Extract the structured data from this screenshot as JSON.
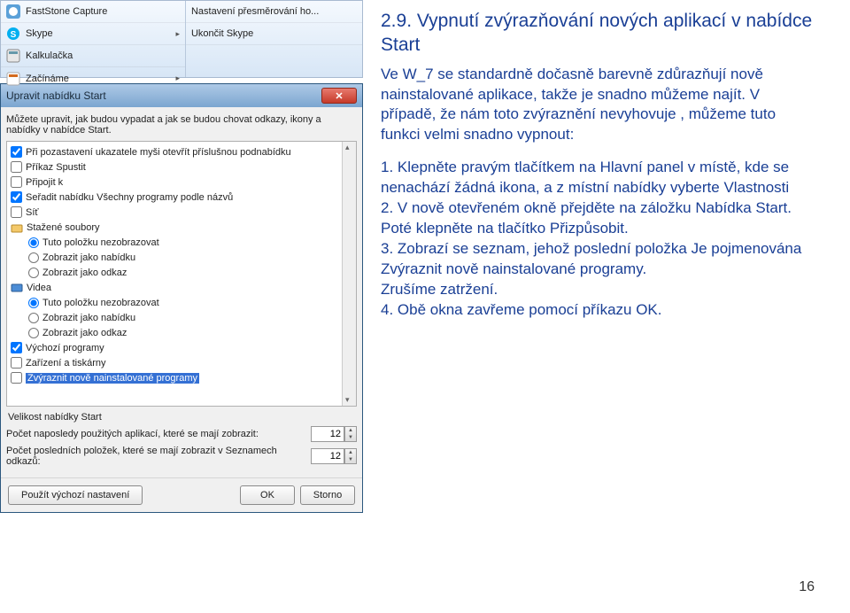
{
  "taskbar": {
    "left": [
      {
        "label": "FastStone Capture",
        "icon": "app-icon"
      },
      {
        "label": "Skype",
        "icon": "skype-icon"
      },
      {
        "label": "Kalkulačka",
        "icon": "calc-icon"
      },
      {
        "label": "Začínáme",
        "icon": "start-icon"
      }
    ],
    "right": [
      {
        "label": "Nastavení přesměrování ho..."
      },
      {
        "label": "Ukončit Skype"
      }
    ]
  },
  "dialog": {
    "title": "Upravit nabídku Start",
    "desc": "Můžete upravit, jak budou vypadat a jak se budou chovat odkazy, ikony a nabídky v nabídce Start.",
    "items": [
      {
        "type": "chk",
        "checked": true,
        "label": "Při pozastavení ukazatele myši otevřít příslušnou podnabídku"
      },
      {
        "type": "chk",
        "checked": false,
        "label": "Příkaz Spustit"
      },
      {
        "type": "chk",
        "checked": false,
        "label": "Připojit k"
      },
      {
        "type": "chk",
        "checked": true,
        "label": "Seřadit nabídku Všechny programy podle názvů"
      },
      {
        "type": "chk",
        "checked": false,
        "label": "Síť"
      },
      {
        "type": "grp",
        "icon": "folder-icon",
        "label": "Stažené soubory"
      },
      {
        "type": "rad",
        "checked": true,
        "label": "Tuto položku nezobrazovat"
      },
      {
        "type": "rad",
        "checked": false,
        "label": "Zobrazit jako nabídku"
      },
      {
        "type": "rad",
        "checked": false,
        "label": "Zobrazit jako odkaz"
      },
      {
        "type": "grp",
        "icon": "video-icon",
        "label": "Videa"
      },
      {
        "type": "rad",
        "checked": true,
        "label": "Tuto položku nezobrazovat"
      },
      {
        "type": "rad",
        "checked": false,
        "label": "Zobrazit jako nabídku"
      },
      {
        "type": "rad",
        "checked": false,
        "label": "Zobrazit jako odkaz"
      },
      {
        "type": "chk",
        "checked": true,
        "label": "Výchozí programy"
      },
      {
        "type": "chk",
        "checked": false,
        "label": "Zařízení a tiskárny"
      },
      {
        "type": "chk-hl",
        "checked": false,
        "label": "Zvýraznit nově nainstalované programy"
      }
    ],
    "size_section": "Velikost nabídky Start",
    "row1_label": "Počet naposledy použitých aplikací, které se mají zobrazit:",
    "row1_value": "12",
    "row2_label": "Počet posledních položek, které se mají zobrazit v Seznamech odkazů:",
    "row2_value": "12",
    "btn_reset": "Použít výchozí nastavení",
    "btn_ok": "OK",
    "btn_cancel": "Storno"
  },
  "article": {
    "heading": "2.9. Vypnutí zvýrazňování nových aplikací v nabídce  Start",
    "para1": "Ve W_7 se standardně dočasně barevně zdůrazňují nově nainstalované aplikace, takže je snadno můžeme najít. V případě, že nám toto zvýraznění nevyhovuje , můžeme tuto funkci velmi snadno vypnout:",
    "li1": "   1. Klepněte pravým tlačítkem na Hlavní panel v místě, kde se nenachází žádná ikona, a z místní nabídky vyberte Vlastnosti",
    "li2": "   2. V nově otevřeném okně přejděte na záložku Nabídka Start. Poté klepněte na tlačítko Přizpůsobit.",
    "li3": "   3. Zobrazí se seznam, jehož poslední položka Je pojmenována Zvýraznit nově nainstalované programy.",
    "li4": "Zrušíme zatržení.",
    "li5": "    4. Obě okna zavřeme pomocí příkazu OK."
  },
  "page_number": "16"
}
